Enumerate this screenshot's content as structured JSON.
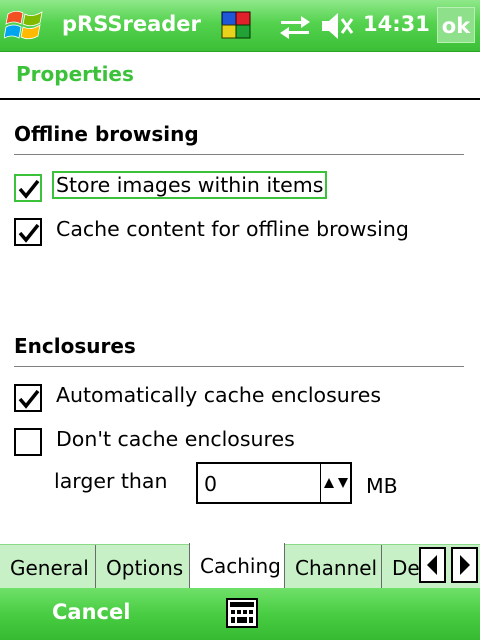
{
  "titlebar": {
    "app_title": "pRSSreader",
    "clock": "14:31",
    "ok_label": "ok",
    "icons": [
      "windows-start-icon",
      "connectivity-icon",
      "sync-icon",
      "volume-icon"
    ]
  },
  "page": {
    "title": "Properties"
  },
  "offline": {
    "section_title": "Offline browsing",
    "store_images": {
      "label": "Store images within items",
      "checked": true
    },
    "cache_content": {
      "label": "Cache content for offline browsing",
      "checked": true
    }
  },
  "enclosures": {
    "section_title": "Enclosures",
    "auto_cache": {
      "label": "Automatically cache enclosures",
      "checked": true
    },
    "dont_cache": {
      "label": "Don't cache enclosures",
      "checked": false
    },
    "larger_than_label": "larger than",
    "size_value": "0",
    "unit": "MB"
  },
  "tabs": {
    "items": [
      "General",
      "Options",
      "Caching",
      "Channel",
      "De"
    ],
    "active": "Caching"
  },
  "menubar": {
    "left_label": "Cancel",
    "icons": [
      "keyboard-icon"
    ]
  },
  "colors": {
    "accent_green": "#3cc23a",
    "bar_green": "#54d24e",
    "tab_bg": "#c8f0c6"
  }
}
